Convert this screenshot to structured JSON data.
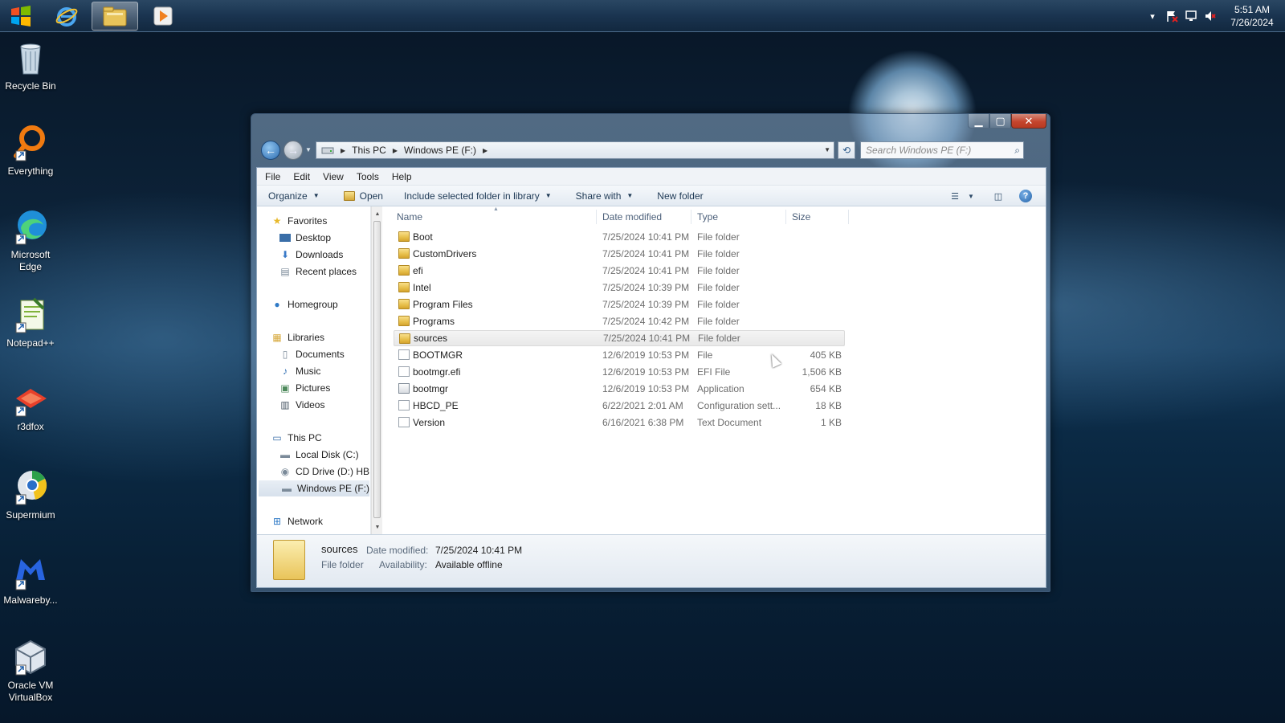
{
  "taskbar": {
    "clock_time": "5:51 AM",
    "clock_date": "7/26/2024",
    "icons": [
      "windows-start-icon",
      "internet-explorer-icon",
      "file-explorer-icon",
      "media-player-icon"
    ],
    "tray_icons": [
      "tray-expand-icon",
      "action-center-flag-icon",
      "network-icon",
      "volume-muted-icon"
    ]
  },
  "desktop": {
    "icons": [
      {
        "label": "Recycle Bin"
      },
      {
        "label": "Everything"
      },
      {
        "label": "Microsoft Edge"
      },
      {
        "label": "Notepad++"
      },
      {
        "label": "r3dfox"
      },
      {
        "label": "Supermium"
      },
      {
        "label": "Malwareby..."
      },
      {
        "label": "Oracle VM VirtualBox"
      }
    ]
  },
  "window": {
    "breadcrumb": [
      "This PC",
      "Windows PE (F:)"
    ],
    "search_placeholder": "Search Windows PE (F:)",
    "menu": [
      "File",
      "Edit",
      "View",
      "Tools",
      "Help"
    ],
    "commands": {
      "organize": "Organize",
      "open": "Open",
      "include": "Include selected folder in library",
      "share": "Share with",
      "new_folder": "New folder"
    },
    "nav": {
      "favorites": "Favorites",
      "desktop": "Desktop",
      "downloads": "Downloads",
      "recent": "Recent places",
      "homegroup": "Homegroup",
      "libraries": "Libraries",
      "documents": "Documents",
      "music": "Music",
      "pictures": "Pictures",
      "videos": "Videos",
      "thispc": "This PC",
      "localdisk": "Local Disk (C:)",
      "cddrive": "CD Drive (D:) HB",
      "winpe": "Windows PE (F:)",
      "network": "Network"
    },
    "columns": {
      "name": "Name",
      "date": "Date modified",
      "type": "Type",
      "size": "Size"
    },
    "files": [
      {
        "name": "Boot",
        "date": "7/25/2024 10:41 PM",
        "type": "File folder",
        "size": ""
      },
      {
        "name": "CustomDrivers",
        "date": "7/25/2024 10:41 PM",
        "type": "File folder",
        "size": ""
      },
      {
        "name": "efi",
        "date": "7/25/2024 10:41 PM",
        "type": "File folder",
        "size": ""
      },
      {
        "name": "Intel",
        "date": "7/25/2024 10:39 PM",
        "type": "File folder",
        "size": ""
      },
      {
        "name": "Program Files",
        "date": "7/25/2024 10:39 PM",
        "type": "File folder",
        "size": ""
      },
      {
        "name": "Programs",
        "date": "7/25/2024 10:42 PM",
        "type": "File folder",
        "size": ""
      },
      {
        "name": "sources",
        "date": "7/25/2024 10:41 PM",
        "type": "File folder",
        "size": ""
      },
      {
        "name": "BOOTMGR",
        "date": "12/6/2019 10:53 PM",
        "type": "File",
        "size": "405 KB"
      },
      {
        "name": "bootmgr.efi",
        "date": "12/6/2019 10:53 PM",
        "type": "EFI File",
        "size": "1,506 KB"
      },
      {
        "name": "bootmgr",
        "date": "12/6/2019 10:53 PM",
        "type": "Application",
        "size": "654 KB"
      },
      {
        "name": "HBCD_PE",
        "date": "6/22/2021 2:01 AM",
        "type": "Configuration sett...",
        "size": "18 KB"
      },
      {
        "name": "Version",
        "date": "6/16/2021 6:38 PM",
        "type": "Text Document",
        "size": "1 KB"
      }
    ],
    "details": {
      "name": "sources",
      "type": "File folder",
      "date_label": "Date modified:",
      "date_value": "7/25/2024 10:41 PM",
      "avail_label": "Availability:",
      "avail_value": "Available offline"
    }
  }
}
